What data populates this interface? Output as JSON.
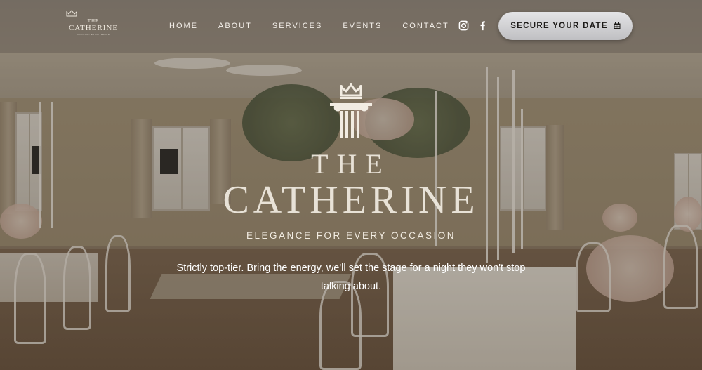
{
  "header": {
    "logo": {
      "the": "THE",
      "name": "CATHERINE",
      "tagline": "A LUXURY EVENT VENUE"
    },
    "nav": [
      {
        "label": "HOME"
      },
      {
        "label": "ABOUT"
      },
      {
        "label": "SERVICES"
      },
      {
        "label": "EVENTS"
      },
      {
        "label": "CONTACT"
      }
    ],
    "social": [
      {
        "icon": "instagram-icon"
      },
      {
        "icon": "facebook-icon"
      }
    ],
    "cta": {
      "label": "SECURE YOUR DATE",
      "icon": "calendar-icon"
    }
  },
  "hero": {
    "emblem_icon": "crown-column-icon",
    "brand_the": "THE",
    "brand_name": "CATHERINE",
    "tagline": "ELEGANCE FOR EVERY OCCASION",
    "intro": "Strictly top-tier. Bring the energy, we'll set the stage for a night they won't stop talking about."
  },
  "colors": {
    "cta_bg": "#d6d6d8",
    "cta_text": "#1c1a18",
    "header_text": "#f4f0ea",
    "brand_text": "#f2ece2"
  }
}
